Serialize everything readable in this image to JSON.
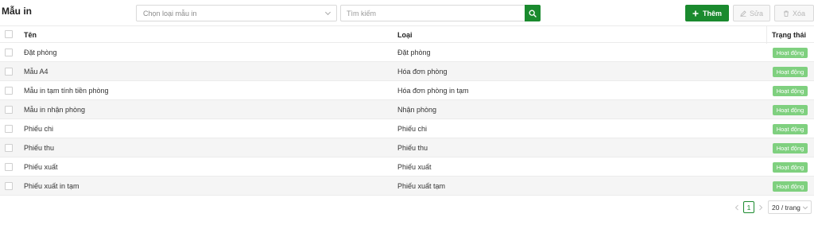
{
  "header": {
    "title": "Mẫu in",
    "type_select": {
      "placeholder": "Chọn loại mẫu in"
    },
    "search": {
      "placeholder": "Tìm kiếm",
      "value": ""
    },
    "add_label": "Thêm",
    "edit_label": "Sửa",
    "delete_label": "Xóa"
  },
  "table": {
    "columns": {
      "name": "Tên",
      "type": "Loại",
      "status": "Trạng thái"
    },
    "rows": [
      {
        "name": "Đặt phòng",
        "type": "Đặt phòng",
        "status": "Hoạt động"
      },
      {
        "name": "Mẫu A4",
        "type": "Hóa đơn phòng",
        "status": "Hoạt động"
      },
      {
        "name": "Mẫu in tạm tính tiền phòng",
        "type": "Hóa đơn phòng in tạm",
        "status": "Hoạt động"
      },
      {
        "name": "Mẫu in nhận phòng",
        "type": "Nhận phòng",
        "status": "Hoạt động"
      },
      {
        "name": "Phiếu chi",
        "type": "Phiếu chi",
        "status": "Hoạt động"
      },
      {
        "name": "Phiếu thu",
        "type": "Phiếu thu",
        "status": "Hoạt động"
      },
      {
        "name": "Phiếu xuất",
        "type": "Phiếu xuất",
        "status": "Hoạt động"
      },
      {
        "name": "Phiếu xuất in tạm",
        "type": "Phiếu xuất tạm",
        "status": "Hoạt động"
      }
    ]
  },
  "pagination": {
    "current_page": "1",
    "page_size": "20 / trang"
  },
  "colors": {
    "primary": "#1a8a2e",
    "status_active": "#7fd07f"
  },
  "icons": {
    "search": "search-icon",
    "add": "plus-icon",
    "edit": "pencil-icon",
    "delete": "trash-icon",
    "dropdown": "chevron-down-icon"
  }
}
